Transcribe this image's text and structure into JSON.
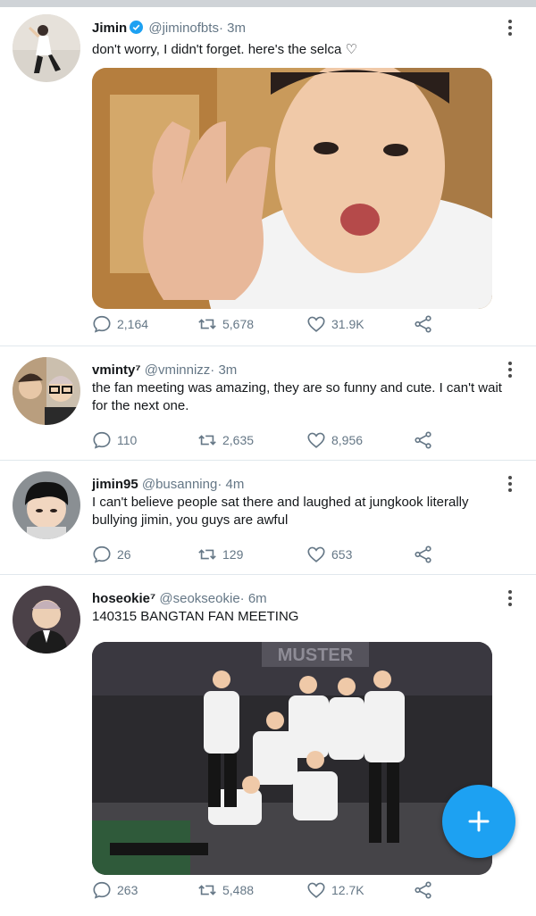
{
  "tweets": [
    {
      "name": "Jimin",
      "verified": true,
      "handle": "@jiminofbts",
      "dot": "·",
      "time": "3m",
      "text": "don't worry, I didn't forget. here's the selca ♡",
      "replies": "2,164",
      "retweets": "5,678",
      "likes": "31.9K"
    },
    {
      "name": "vminty⁷",
      "verified": false,
      "handle": "@vminnizz",
      "dot": "·",
      "time": "3m",
      "text": "the fan meeting was amazing, they are so funny and cute. I can't wait for the next one.",
      "replies": "110",
      "retweets": "2,635",
      "likes": "8,956"
    },
    {
      "name": "jimin95",
      "verified": false,
      "handle": "@busanning",
      "dot": "·",
      "time": "4m",
      "text": "I can't believe people sat there and laughed at jungkook literally bullying jimin, you guys are awful",
      "replies": "26",
      "retweets": "129",
      "likes": "653"
    },
    {
      "name": "hoseokie⁷",
      "verified": false,
      "handle": "@seokseokie",
      "dot": "·",
      "time": "6m",
      "text": "140315 BANGTAN FAN MEETING",
      "replies": "263",
      "retweets": "5,488",
      "likes": "12.7K",
      "media_text": "MUSTER"
    }
  ],
  "icons": {
    "reply": "reply-icon",
    "retweet": "retweet-icon",
    "like": "heart-icon",
    "share": "share-icon",
    "more": "more-vertical-icon",
    "compose": "plus-icon",
    "verified": "verified-badge-icon"
  },
  "colors": {
    "accent": "#1da1f2",
    "muted": "#657786",
    "text": "#14171a"
  }
}
